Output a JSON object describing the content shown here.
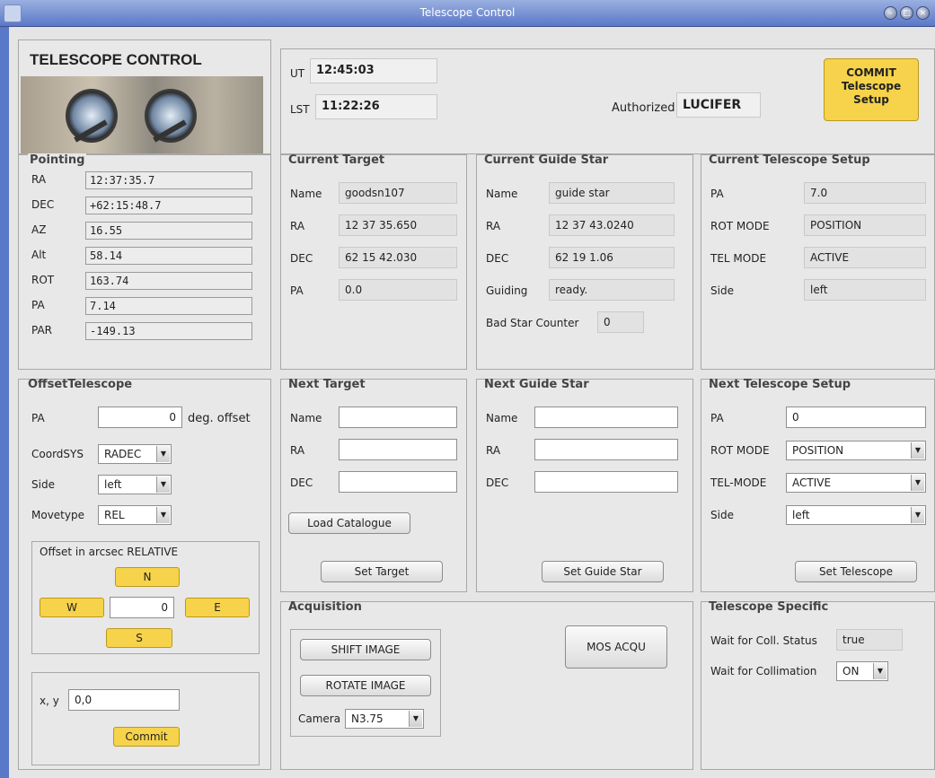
{
  "window": {
    "title": "Telescope Control"
  },
  "header": {
    "app_title": "TELESCOPE CONTROL",
    "ut_label": "UT",
    "ut_value": "12:45:03",
    "lst_label": "LST",
    "lst_value": "11:22:26",
    "authorized_label": "Authorized:",
    "authorized_value": "LUCIFER",
    "commit_button": {
      "line1": "COMMIT",
      "line2": "Telescope",
      "line3": "Setup"
    }
  },
  "pointing": {
    "title": "Pointing",
    "rows": [
      {
        "label": "RA",
        "value": "  12:37:35.7"
      },
      {
        "label": "DEC",
        "value": "+62:15:48.7"
      },
      {
        "label": "AZ",
        "value": "16.55"
      },
      {
        "label": "Alt",
        "value": "58.14"
      },
      {
        "label": "ROT",
        "value": "163.74"
      },
      {
        "label": "PA",
        "value": "7.14"
      },
      {
        "label": "PAR",
        "value": "-149.13"
      }
    ]
  },
  "current_target": {
    "title": "Current Target",
    "rows": [
      {
        "label": "Name",
        "value": "goodsn107"
      },
      {
        "label": "RA",
        "value": "12 37 35.650"
      },
      {
        "label": "DEC",
        "value": "62 15 42.030"
      },
      {
        "label": "PA",
        "value": "0.0"
      }
    ]
  },
  "current_guide": {
    "title": "Current Guide Star",
    "rows": [
      {
        "label": "Name",
        "value": "guide star"
      },
      {
        "label": "RA",
        "value": "12 37 43.0240"
      },
      {
        "label": "DEC",
        "value": "62 19 1.06"
      },
      {
        "label": "Guiding",
        "value": "ready."
      }
    ],
    "bad_star_label": "Bad Star Counter",
    "bad_star_value": "0"
  },
  "current_setup": {
    "title": "Current Telescope Setup",
    "rows": [
      {
        "label": "PA",
        "value": "7.0"
      },
      {
        "label": "ROT MODE",
        "value": "POSITION"
      },
      {
        "label": "TEL MODE",
        "value": "ACTIVE"
      },
      {
        "label": "Side",
        "value": "left"
      }
    ]
  },
  "offset": {
    "title": "OffsetTelescope",
    "pa_label": "PA",
    "pa_value": "0",
    "pa_unit": "deg. offset",
    "coordsys_label": "CoordSYS",
    "coordsys_value": "RADEC",
    "side_label": "Side",
    "side_value": "left",
    "movetype_label": "Movetype",
    "movetype_value": "REL",
    "arcsec_label": "Offset in arcsec  RELATIVE",
    "n": "N",
    "w": "W",
    "e": "E",
    "s": "S",
    "step_value": "0",
    "xy_label": "x, y",
    "xy_value": "0,0",
    "commit": "Commit"
  },
  "next_target": {
    "title": "Next Target",
    "name_label": "Name",
    "ra_label": "RA",
    "dec_label": "DEC",
    "load_button": "Load Catalogue",
    "set_button": "Set Target"
  },
  "next_guide": {
    "title": "Next Guide Star",
    "name_label": "Name",
    "ra_label": "RA",
    "dec_label": "DEC",
    "set_button": "Set Guide Star"
  },
  "next_setup": {
    "title": "Next Telescope Setup",
    "pa_label": "PA",
    "pa_value": "0",
    "rot_label": "ROT MODE",
    "rot_value": "POSITION",
    "tel_label": "TEL-MODE",
    "tel_value": "ACTIVE",
    "side_label": "Side",
    "side_value": "left",
    "set_button": "Set Telescope"
  },
  "acquisition": {
    "title": "Acquisition",
    "shift": "SHIFT IMAGE",
    "rotate": "ROTATE IMAGE",
    "camera_label": "Camera",
    "camera_value": "N3.75",
    "mos": "MOS ACQU"
  },
  "specific": {
    "title": "Telescope Specific",
    "coll_status_label": "Wait for Coll. Status",
    "coll_status_value": "true",
    "collimation_label": "Wait for Collimation",
    "collimation_value": "ON"
  },
  "colors": {
    "accent_yellow": "#f6d34a",
    "titlebar_blue": "#5a78c8"
  },
  "icons": [
    "java-app-icon",
    "minimize-icon",
    "maximize-icon",
    "close-icon",
    "chevron-down-icon"
  ]
}
